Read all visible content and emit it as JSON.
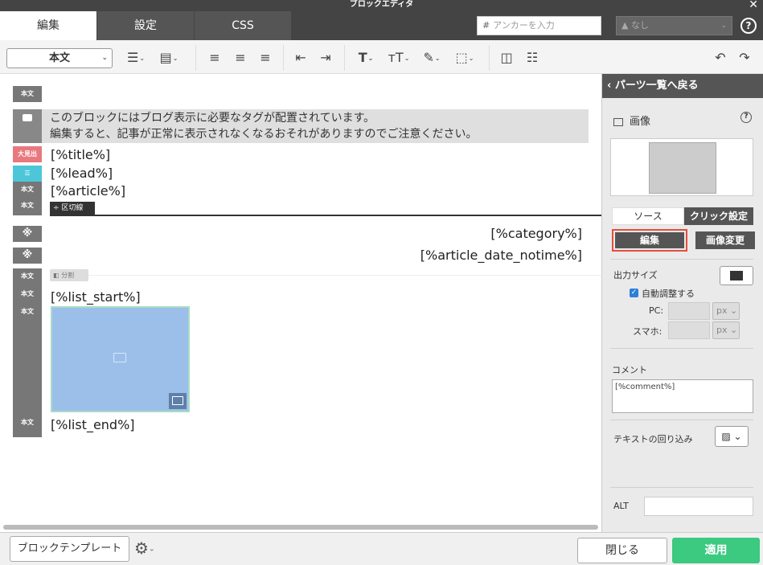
{
  "window": {
    "title": "ブロックエディタ",
    "close_glyph": "✕"
  },
  "tabs": [
    {
      "label": "編集"
    },
    {
      "label": "設定"
    },
    {
      "label": "CSS"
    }
  ],
  "anchor": {
    "hash": "#",
    "placeholder": "アンカーを入力"
  },
  "class_select": {
    "value": "なし"
  },
  "help_glyph": "?",
  "toolbar": {
    "style_value": "本文"
  },
  "editor": {
    "labels": {
      "body": "本文",
      "heading": "大見出",
      "separator": "区切線",
      "split": "分割"
    },
    "notice_lines": [
      "このブロックにはブログ表示に必要なタグが配置されています。",
      "編集すると、記事が正常に表示されなくなるおそれがありますのでご注意ください。"
    ],
    "lines": {
      "title": "[%title%]",
      "lead": "[%lead%]",
      "article": "[%article%]",
      "category": "[%category%]",
      "date": "[%article_date_notime%]",
      "list_start": "[%list_start%]",
      "list_end": "[%list_end%]"
    },
    "asterisk": "※"
  },
  "panel": {
    "back_label": "パーツ一覧へ戻る",
    "title": "画像",
    "tabs": {
      "source": "ソース",
      "click": "クリック設定"
    },
    "edit_button": "編集",
    "change_button": "画像変更",
    "output_size": "出力サイズ",
    "auto_adjust": "自動調整する",
    "pc_label": "PC:",
    "sp_label": "スマホ:",
    "unit": "px",
    "comment_label": "コメント",
    "comment_value": "[%comment%]",
    "wrap_label": "テキストの回り込み",
    "alt_label": "ALT"
  },
  "footer": {
    "template_button": "ブロックテンプレート",
    "close_button": "閉じる",
    "apply_button": "適用"
  },
  "colors": {
    "dark": "#444444",
    "accent_red": "#e74c3c",
    "apply_green": "#3cc980",
    "image_blue": "#9cbfea",
    "heading_label": "#e8787f",
    "lead_label": "#4cc6d8"
  }
}
